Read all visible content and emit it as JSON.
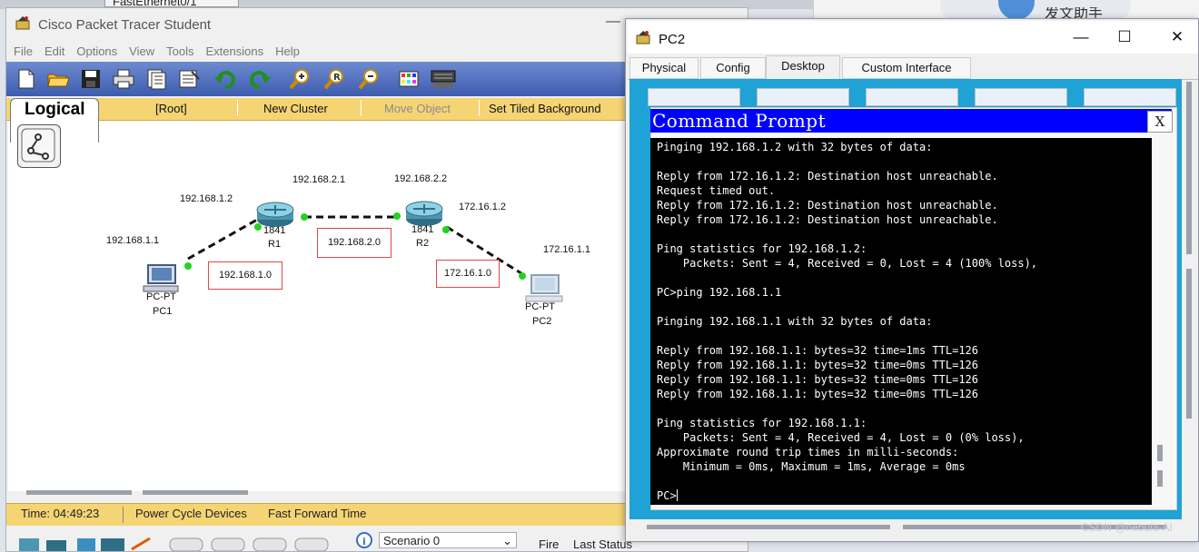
{
  "background": {
    "tab_label": "FastEthernet0/1",
    "app_label": "发文助手"
  },
  "pt": {
    "title": "Cisco Packet Tracer Student",
    "minimize": "—",
    "menu": [
      "File",
      "Edit",
      "Options",
      "View",
      "Tools",
      "Extensions",
      "Help"
    ],
    "toolbar_icons": [
      "new-file-icon",
      "open-folder-icon",
      "save-icon",
      "print-icon",
      "activity-wizard-icon",
      "notes-icon",
      "undo-icon",
      "redo-icon",
      "zoom-in-icon",
      "zoom-reset-icon",
      "zoom-out-icon",
      "palette-icon",
      "custom-device-icon"
    ],
    "logical_label": "Logical",
    "root_label": "[Root]",
    "new_cluster": "New Cluster",
    "move_object": "Move Object",
    "tiled_bg": "Set Tiled Background",
    "devices": {
      "r1_model": "1841",
      "r1_name": "R1",
      "r2_model": "1841",
      "r2_name": "R2",
      "pc1_model": "PC-PT",
      "pc1_name": "PC1",
      "pc2_model": "PC-PT",
      "pc2_name": "PC2"
    },
    "ips": {
      "pc1": "192.168.1.1",
      "r1_g": "192.168.1.2",
      "r1_s": "192.168.2.1",
      "r2_s": "192.168.2.2",
      "r2_g": "172.16.1.2",
      "pc2": "172.16.1.1"
    },
    "networks": [
      "192.168.1.0",
      "192.168.2.0",
      "172.16.1.0"
    ],
    "status": {
      "time": "Time: 04:49:23",
      "power": "Power Cycle Devices",
      "fast_forward": "Fast Forward Time"
    },
    "scenario": "Scenario 0",
    "fire": "Fire",
    "last_status": "Last Status"
  },
  "pc2": {
    "title": "PC2",
    "tabs": [
      "Physical",
      "Config",
      "Desktop",
      "Custom Interface"
    ],
    "active_tab": "Desktop",
    "cmd_title": "Command Prompt",
    "cmd_close": "X",
    "cmd_output": "Pinging 192.168.1.2 with 32 bytes of data:\n\nReply from 172.16.1.2: Destination host unreachable.\nRequest timed out.\nReply from 172.16.1.2: Destination host unreachable.\nReply from 172.16.1.2: Destination host unreachable.\n\nPing statistics for 192.168.1.2:\n    Packets: Sent = 4, Received = 0, Lost = 4 (100% loss),\n\nPC>ping 192.168.1.1\n\nPinging 192.168.1.1 with 32 bytes of data:\n\nReply from 192.168.1.1: bytes=32 time=1ms TTL=126\nReply from 192.168.1.1: bytes=32 time=0ms TTL=126\nReply from 192.168.1.1: bytes=32 time=0ms TTL=126\nReply from 192.168.1.1: bytes=32 time=0ms TTL=126\n\nPing statistics for 192.168.1.1:\n    Packets: Sent = 4, Received = 4, Lost = 0 (0% loss),\nApproximate round trip times in milli-seconds:\n    Minimum = 0ms, Maximum = 1ms, Average = 0ms\n\n",
    "cmd_prompt": "PC>"
  },
  "watermark": "CSDN @nebula-AI",
  "colors": {
    "toolbar": "#4f6ec0",
    "yellow_bar": "#f5d474",
    "cmd_title": "#0000fd",
    "desktop": "#1fa2d5",
    "link_green": "#22d322",
    "network_box": "#e04848"
  }
}
